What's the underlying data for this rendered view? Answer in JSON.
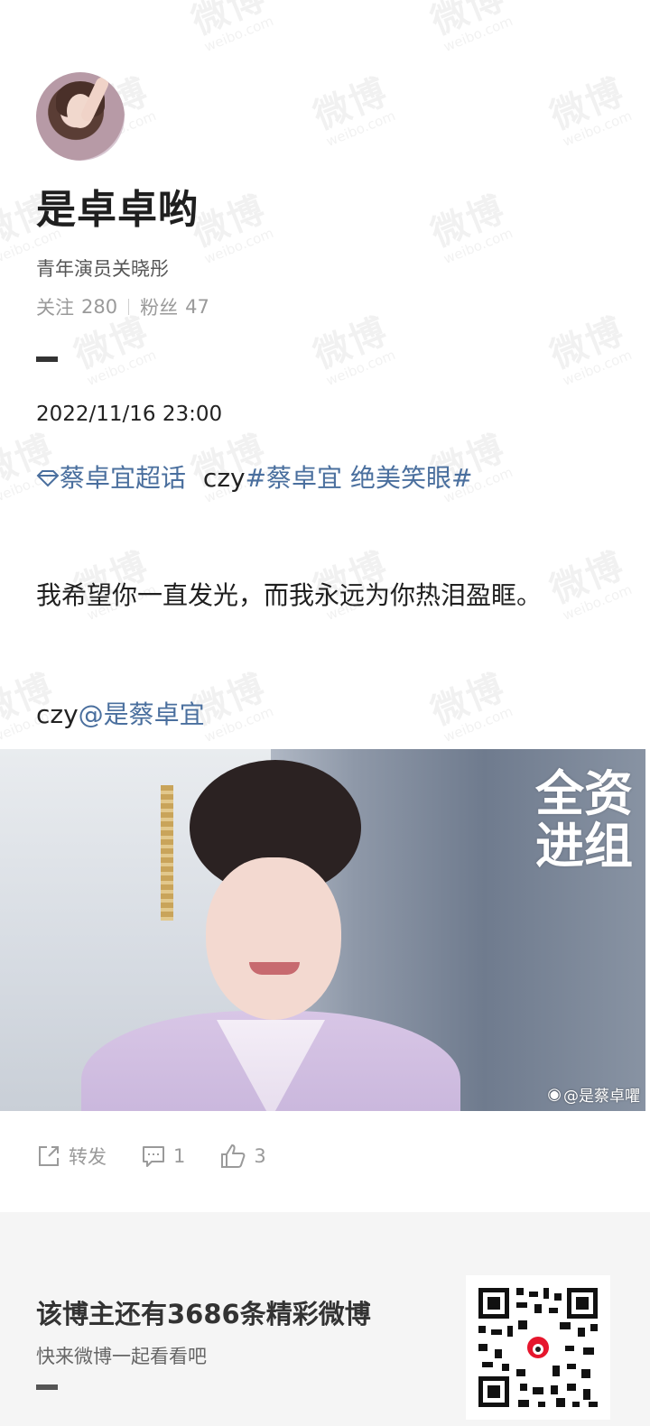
{
  "watermark": {
    "text": "微博",
    "sub": "weibo.com"
  },
  "profile": {
    "name": "是卓卓哟",
    "intro": "青年演员关晓彤",
    "follow_label": "关注",
    "follow_count": "280",
    "fans_label": "粉丝",
    "fans_count": "47"
  },
  "post": {
    "date": "2022/11/16 23:00",
    "topic_link": "蔡卓宜超话",
    "topic_prefix": "czy",
    "hashtag": "#蔡卓宜 绝美笑眼#",
    "body": "我希望你一直发光，而我永远为你热泪盈眶。",
    "mention_prefix": "czy",
    "mention": "@是蔡卓宜",
    "image": {
      "logo_text": "全资进组",
      "credit": "@是蔡卓㘗"
    }
  },
  "actions": {
    "repost_label": "转发",
    "comment_count": "1",
    "like_count": "3"
  },
  "footer": {
    "title": "该博主还有3686条精彩微博",
    "subtitle": "快来微博一起看看吧"
  }
}
